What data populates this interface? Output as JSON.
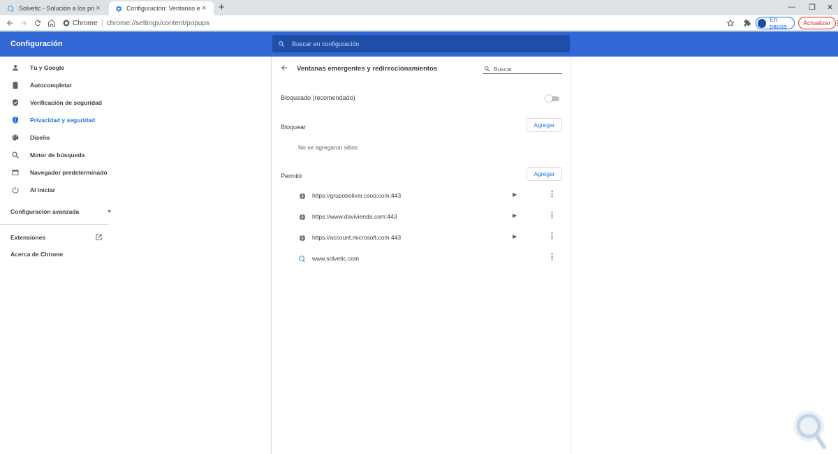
{
  "browser": {
    "tabs": [
      {
        "title": "Solvetic - Solución a los problemas",
        "active": false,
        "favicon": "solvetic-favicon"
      },
      {
        "title": "Configuración: Ventanas emergentes",
        "active": true,
        "favicon": "gear-icon"
      }
    ],
    "new_tab": "+",
    "address": {
      "site_label": "Chrome",
      "url": "chrome://settings/content/popups"
    },
    "profile_label": "En pausa",
    "update_label": "Actualizar"
  },
  "header": {
    "title": "Configuración",
    "search_placeholder": "Buscar en configuración"
  },
  "sidebar": {
    "items": [
      {
        "label": "Tú y Google",
        "icon": "person-icon",
        "active": false
      },
      {
        "label": "Autocompletar",
        "icon": "clipboard-icon",
        "active": false
      },
      {
        "label": "Verificación de seguridad",
        "icon": "shield-check-icon",
        "active": false
      },
      {
        "label": "Privacidad y seguridad",
        "icon": "shield-icon",
        "active": true
      },
      {
        "label": "Diseño",
        "icon": "palette-icon",
        "active": false
      },
      {
        "label": "Motor de búsqueda",
        "icon": "search-icon",
        "active": false
      },
      {
        "label": "Navegador predeterminado",
        "icon": "browser-icon",
        "active": false
      },
      {
        "label": "Al iniciar",
        "icon": "power-icon",
        "active": false
      }
    ],
    "advanced_label": "Configuración avanzada",
    "extensions_label": "Extensiones",
    "about_label": "Acerca de Chrome"
  },
  "page": {
    "title": "Ventanas emergentes y redireccionamientos",
    "search_placeholder": "Buscar",
    "blocked_label": "Bloqueado (recomendado)",
    "blocked_on": false,
    "block_section": "Bloquear",
    "add_label": "Agregar",
    "block_empty": "No se agregaron sitios",
    "allow_section": "Permitir",
    "allowed_sites": [
      {
        "url": "https://grupobolivar.csod.com:443",
        "icon": "globe-icon",
        "has_arrow": true
      },
      {
        "url": "https://www.davivienda.com:443",
        "icon": "globe-icon",
        "has_arrow": true
      },
      {
        "url": "https://account.microsoft.com:443",
        "icon": "globe-icon",
        "has_arrow": true
      },
      {
        "url": "www.solvetic.com",
        "icon": "solvetic-icon",
        "has_arrow": false
      }
    ]
  },
  "colors": {
    "header": "#3367d6",
    "accent": "#1a73e8",
    "update": "#d93025"
  }
}
